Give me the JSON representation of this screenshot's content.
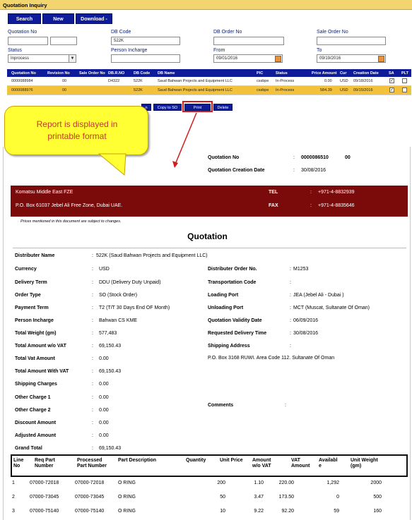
{
  "app": {
    "title": "Quotation Inquiry",
    "buttons": {
      "search": "Search",
      "new": "New",
      "download": "Download -"
    },
    "filters": {
      "quotation_no_label": "Quotation No",
      "db_code_label": "DB Code",
      "db_code_value": "522K",
      "db_order_no_label": "DB Order No",
      "sale_order_no_label": "Sale Order No",
      "status_label": "Status",
      "status_value": "Inprocess",
      "person_incharge_label": "Person Incharge",
      "from_label": "From",
      "from_value": "09/01/2016",
      "to_label": "To",
      "to_value": "09/19/2016"
    },
    "grid": {
      "columns": [
        "Quotation No",
        "Revision No",
        "Sale Order No",
        "DB.R.NO",
        "DB Code",
        "DB Name",
        "PIC",
        "Status",
        "Price Amount",
        "Cur",
        "Creation Date",
        "SA",
        "PLT"
      ],
      "rows": [
        {
          "quotation_no": "0000088984",
          "revision_no": "00",
          "sale_order_no": "",
          "dbr_no": "D4322",
          "db_code": "522K",
          "db_name": "Saud Bahwan Projects and Equipment LLC",
          "pic": "cssbpe",
          "status": "In-Process",
          "price": "0.00",
          "cur": "USD",
          "date": "09/18/2016",
          "sa": "✓",
          "plt": ""
        },
        {
          "quotation_no": "0000088976",
          "revision_no": "00",
          "sale_order_no": "",
          "dbr_no": "",
          "db_code": "522K",
          "db_name": "Saud Bahwan Projects and Equipment LLC",
          "pic": "cssbpe",
          "status": "In-Process",
          "price": "584.39",
          "cur": "USD",
          "date": "09/15/2016",
          "sa": "✓",
          "plt": ""
        }
      ]
    },
    "actions": {
      "partial": "n",
      "copy": "Copy to SO",
      "print": "Print",
      "delete": "Delete"
    }
  },
  "callout": {
    "line1": "Report is displayed in",
    "line2": "printable format"
  },
  "report": {
    "quotation_no_label": "Quotation No",
    "quotation_no_value": "0000086510",
    "quotation_rev": "00",
    "creation_date_label": "Quotation Creation Date",
    "creation_date_value": "30/08/2016",
    "company_name": "Komatsu Middle East FZE",
    "company_address": "P.O. Box 61037 Jebel Ali Free Zone, Dubai UAE.",
    "tel_label": "TEL",
    "tel_value": "+971-4-8832939",
    "fax_label": "FAX",
    "fax_value": "+971-4-8835646",
    "note": "Prices mentioned in this document are subject to changes.",
    "doc_title": "Quotation",
    "distributor_name_label": "Distributer Name",
    "distributor_name_value": "522K (Saud Bahwan Projects and Equipment LLC)",
    "left_fields": [
      {
        "label": "Currency",
        "value": "USD"
      },
      {
        "label": "Delivery Term",
        "value": "DDU (Delivery Duty Unpaid)"
      },
      {
        "label": "Order Type",
        "value": "SO (Stock Order)"
      },
      {
        "label": "Payment Term",
        "value": "T2 (T/T  30 Days End OF Month)"
      },
      {
        "label": "Person Incharge",
        "value": "Bahwan CS KME"
      },
      {
        "label": "Total Weight (gm)",
        "value": "577,483"
      },
      {
        "label": "Total  Amount w/o VAT",
        "value": "69,150.43"
      },
      {
        "label": "Total Vat Amount",
        "value": "0.00"
      },
      {
        "label": "Total Amount With VAT",
        "value": "69,150.43"
      },
      {
        "label": "Shipping Charges",
        "value": "0.00"
      },
      {
        "label": "Other Charge 1",
        "value": "0.00"
      },
      {
        "label": "Other Charge 2",
        "value": "0.00"
      },
      {
        "label": "Discount Amount",
        "value": "0.00"
      },
      {
        "label": "Adjusted Amount",
        "value": "0.00"
      },
      {
        "label": "Grand Total",
        "value": "69,150.43"
      }
    ],
    "right_fields": [
      {
        "label": "Distributer Order No.",
        "value": "M1253"
      },
      {
        "label": "Transportation Code",
        "value": ""
      },
      {
        "label": "Loading Port",
        "value": "JEA (Jebel Ali - Dubai )"
      },
      {
        "label": "Unloading Port",
        "value": "MCT (Muscat, Sultanate Of Oman)"
      },
      {
        "label": "Quotation Validity Date",
        "value": "06/09/2016"
      },
      {
        "label": "Requested Delivery Time",
        "value": "30/08/2016"
      },
      {
        "label": "Shipping Address",
        "value": ""
      }
    ],
    "shipping_address": "P.O. Box 3168 RUWI. Area Code 112. Sultanate Of Oman",
    "comments_label": "Comments",
    "items_header": {
      "line_no": [
        "Line",
        "No"
      ],
      "req_part": [
        "Req Part",
        "Number"
      ],
      "proc_part": [
        "Processed",
        "Part Number"
      ],
      "desc": [
        "Part Description"
      ],
      "qty": [
        "Quantity"
      ],
      "unit_price": [
        "Unit Price"
      ],
      "amount": [
        "Amount",
        "w/o VAT"
      ],
      "vat": [
        "VAT",
        "Amount"
      ],
      "avail": [
        "Availabl",
        "e"
      ],
      "weight": [
        "Unit Weight",
        "(gm)"
      ]
    },
    "items": [
      {
        "line": "1",
        "req": "07000-72018",
        "proc": "07000-72018",
        "desc": "O RING",
        "qty": "200",
        "price": "1.10",
        "amount": "220.00",
        "vat": "",
        "avail": "1,292",
        "weight": "2000"
      },
      {
        "line": "2",
        "req": "07000-73045",
        "proc": "07000-73045",
        "desc": "O RING",
        "qty": "50",
        "price": "3.47",
        "amount": "173.50",
        "vat": "",
        "avail": "0",
        "weight": "500"
      },
      {
        "line": "3",
        "req": "07000-75140",
        "proc": "07000-75140",
        "desc": "O RING",
        "qty": "10",
        "price": "9.22",
        "amount": "92.20",
        "vat": "",
        "avail": "59",
        "weight": "160"
      }
    ]
  },
  "colors": {
    "accent_blue": "#0f1c9a",
    "title_gold": "#f3d56f",
    "selected_row": "#f3c13a",
    "banner_red": "#7b0b0b",
    "callout_yellow": "#ffff33",
    "highlight_red": "#d21b1b"
  }
}
